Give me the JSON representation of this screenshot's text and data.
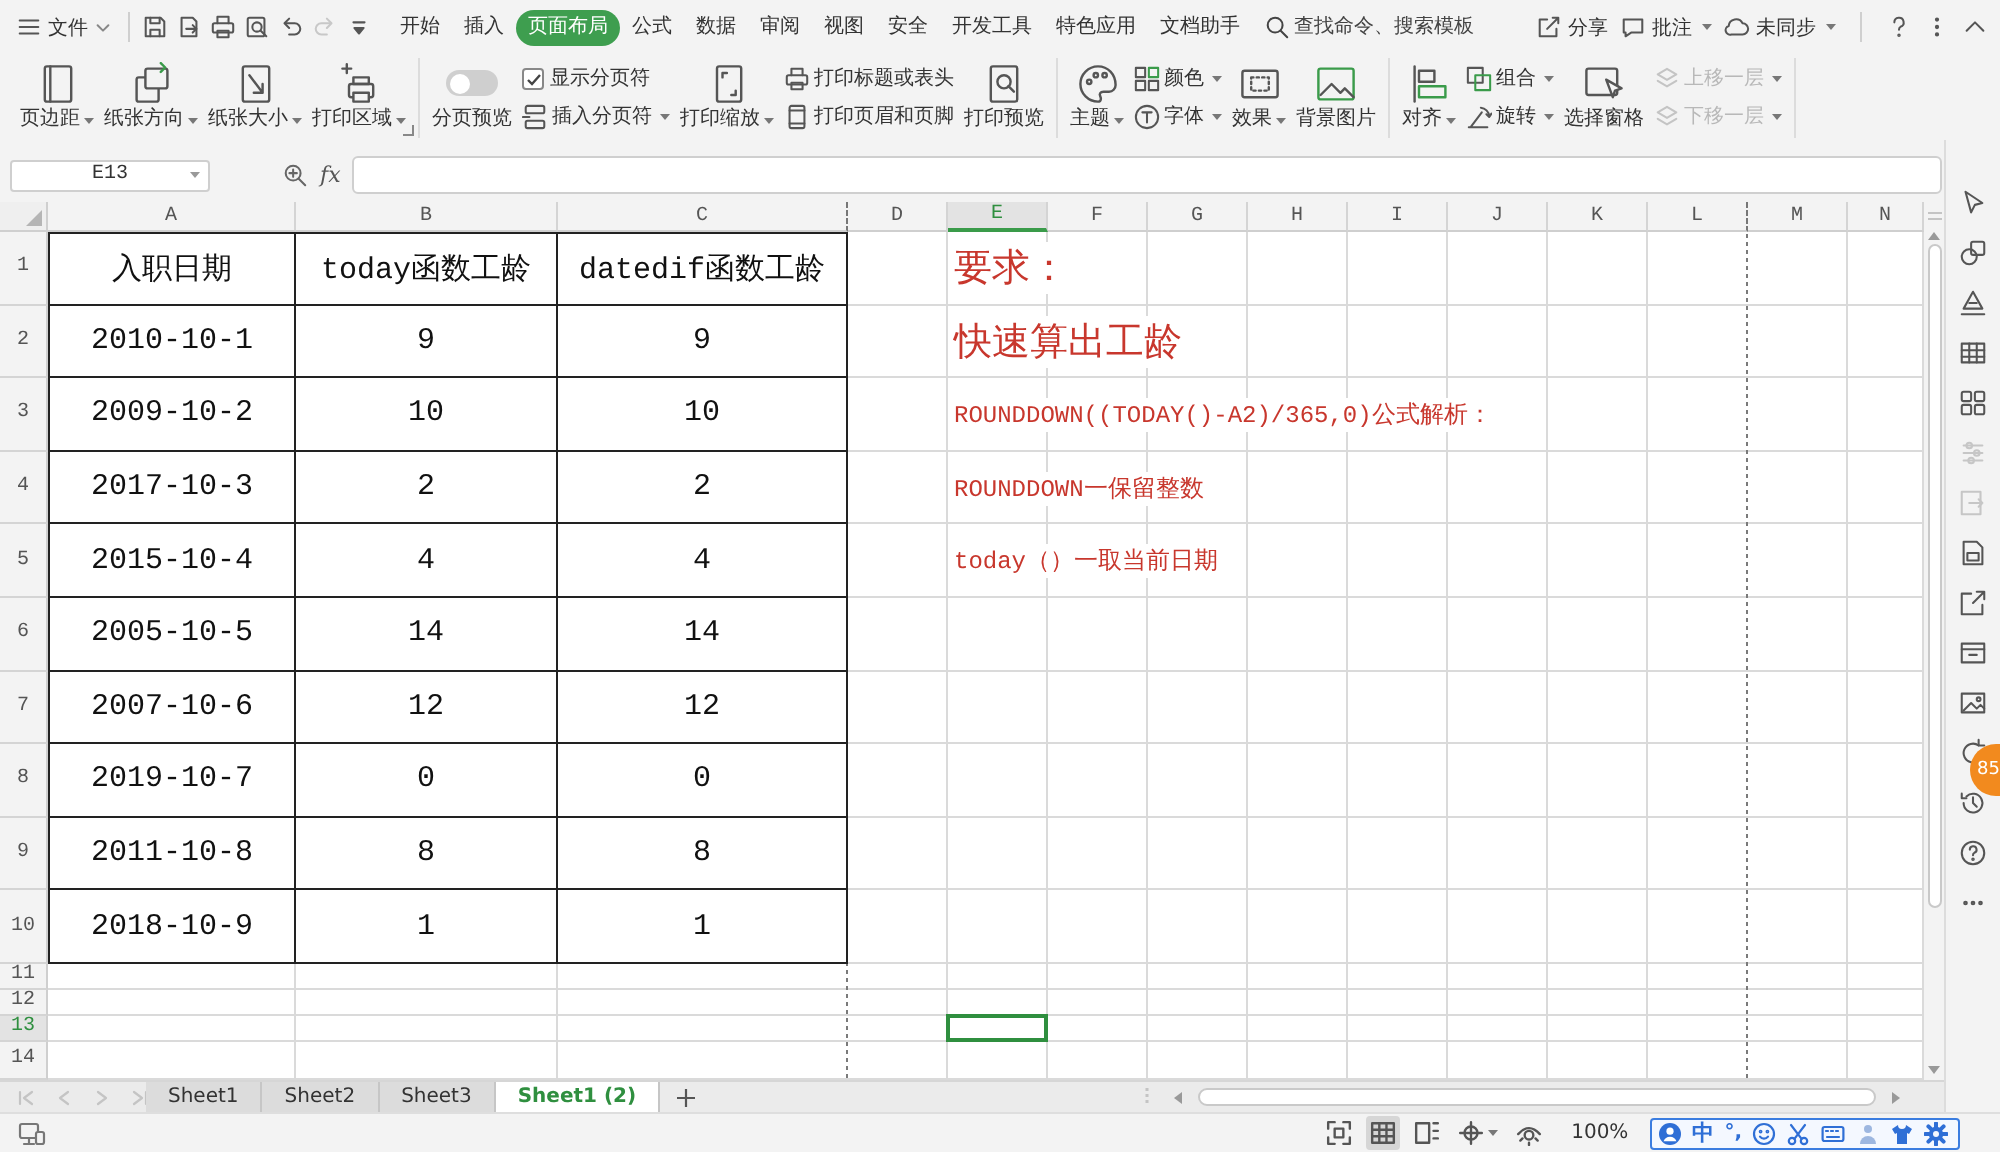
{
  "menu_bar": {
    "file_menu": "文件",
    "quick_access": [
      {
        "disabled": false
      },
      {
        "disabled": false
      },
      {
        "disabled": false
      },
      {
        "disabled": false
      },
      {
        "disabled": false
      },
      {
        "disabled": true
      },
      {
        "disabled": false
      }
    ],
    "tabs": [
      {
        "label": "开始",
        "selected": false
      },
      {
        "label": "插入",
        "selected": false
      },
      {
        "label": "页面布局",
        "selected": true
      },
      {
        "label": "公式",
        "selected": false
      },
      {
        "label": "数据",
        "selected": false
      },
      {
        "label": "审阅",
        "selected": false
      },
      {
        "label": "视图",
        "selected": false
      },
      {
        "label": "安全",
        "selected": false
      },
      {
        "label": "开发工具",
        "selected": false
      },
      {
        "label": "特色应用",
        "selected": false
      },
      {
        "label": "文档助手",
        "selected": false
      }
    ],
    "search": {
      "placeholder": "查找命令、搜索模板"
    },
    "actions": [
      {
        "label": "分享",
        "dropdown": false
      },
      {
        "label": "批注",
        "dropdown": true
      },
      {
        "label": "未同步",
        "dropdown": true
      }
    ]
  },
  "ribbon": {
    "groups": [
      {
        "items": [
          {
            "kind": "large",
            "label": "页边距",
            "dropdown": true
          },
          {
            "kind": "large",
            "label": "纸张方向",
            "dropdown": true
          },
          {
            "kind": "large",
            "label": "纸张大小",
            "dropdown": true
          },
          {
            "kind": "large",
            "label": "打印区域",
            "dropdown": true
          }
        ]
      },
      {
        "items": [
          {
            "kind": "toggle",
            "label": "分页预览",
            "on": false
          },
          {
            "kind": "stack",
            "items": [
              {
                "kind": "checkbox",
                "label": "显示分页符",
                "checked": true
              },
              {
                "kind": "small",
                "label": "插入分页符",
                "dropdown": true,
                "disabled": false
              }
            ]
          },
          {
            "kind": "large",
            "label": "打印缩放",
            "dropdown": true
          },
          {
            "kind": "stack",
            "items": [
              {
                "kind": "small",
                "label": "打印标题或表头",
                "dropdown": false,
                "disabled": false
              },
              {
                "kind": "small",
                "label": "打印页眉和页脚",
                "dropdown": false,
                "disabled": false
              }
            ]
          },
          {
            "kind": "large",
            "label": "打印预览",
            "dropdown": false
          }
        ]
      },
      {
        "items": [
          {
            "kind": "large",
            "label": "主题",
            "dropdown": true
          },
          {
            "kind": "stack",
            "items": [
              {
                "kind": "small",
                "label": "颜色",
                "dropdown": true,
                "disabled": false
              },
              {
                "kind": "small",
                "label": "字体",
                "dropdown": true,
                "disabled": false
              }
            ]
          },
          {
            "kind": "large",
            "label": "效果",
            "dropdown": true
          },
          {
            "kind": "large",
            "label": "背景图片",
            "dropdown": false
          }
        ]
      },
      {
        "items": [
          {
            "kind": "large",
            "label": "对齐",
            "dropdown": true
          },
          {
            "kind": "stack",
            "items": [
              {
                "kind": "small",
                "label": "组合",
                "dropdown": true,
                "disabled": false
              },
              {
                "kind": "small",
                "label": "旋转",
                "dropdown": true,
                "disabled": false
              }
            ]
          },
          {
            "kind": "large",
            "label": "选择窗格",
            "dropdown": false
          },
          {
            "kind": "stack",
            "items": [
              {
                "kind": "small",
                "label": "上移一层",
                "dropdown": true,
                "disabled": true
              },
              {
                "kind": "small",
                "label": "下移一层",
                "dropdown": true,
                "disabled": true
              }
            ]
          }
        ]
      }
    ]
  },
  "formula_bar": {
    "name_box": "E13",
    "function_label": "fx"
  },
  "sheet": {
    "columns": [
      {
        "label": "A",
        "selected": false,
        "page_break": false
      },
      {
        "label": "B",
        "selected": false,
        "page_break": false
      },
      {
        "label": "C",
        "selected": false,
        "page_break": true
      },
      {
        "label": "D",
        "selected": false,
        "page_break": false
      },
      {
        "label": "E",
        "selected": true,
        "page_break": false
      },
      {
        "label": "F",
        "selected": false,
        "page_break": false
      },
      {
        "label": "G",
        "selected": false,
        "page_break": false
      },
      {
        "label": "H",
        "selected": false,
        "page_break": false
      },
      {
        "label": "I",
        "selected": false,
        "page_break": false
      },
      {
        "label": "J",
        "selected": false,
        "page_break": false
      },
      {
        "label": "K",
        "selected": false,
        "page_break": false
      },
      {
        "label": "L",
        "selected": false,
        "page_break": true
      },
      {
        "label": "M",
        "selected": false,
        "page_break": false
      },
      {
        "label": "N",
        "selected": false,
        "page_break": false
      }
    ],
    "rows": [
      {
        "label": "1",
        "selected": false
      },
      {
        "label": "2",
        "selected": false
      },
      {
        "label": "3",
        "selected": false
      },
      {
        "label": "4",
        "selected": false
      },
      {
        "label": "5",
        "selected": false
      },
      {
        "label": "6",
        "selected": false
      },
      {
        "label": "7",
        "selected": false
      },
      {
        "label": "8",
        "selected": false
      },
      {
        "label": "9",
        "selected": false
      },
      {
        "label": "10",
        "selected": false
      },
      {
        "label": "11",
        "selected": false
      },
      {
        "label": "12",
        "selected": false
      },
      {
        "label": "13",
        "selected": true
      },
      {
        "label": "14",
        "selected": false
      }
    ]
  },
  "table": {
    "header": [
      "入职日期",
      "today函数工龄",
      "datedif函数工龄"
    ],
    "rows": [
      [
        "2010-10-1",
        "9",
        "9"
      ],
      [
        "2009-10-2",
        "10",
        "10"
      ],
      [
        "2017-10-3",
        "2",
        "2"
      ],
      [
        "2015-10-4",
        "4",
        "4"
      ],
      [
        "2005-10-5",
        "14",
        "14"
      ],
      [
        "2007-10-6",
        "12",
        "12"
      ],
      [
        "2019-10-7",
        "0",
        "0"
      ],
      [
        "2011-10-8",
        "8",
        "8"
      ],
      [
        "2018-10-9",
        "1",
        "1"
      ]
    ]
  },
  "notes": [
    {
      "kind": "heading",
      "text": "要求："
    },
    {
      "kind": "heading",
      "text": "快速算出工龄"
    },
    {
      "kind": "body",
      "text": "ROUNDDOWN((TODAY()-A2)/365,0)公式解析："
    },
    {
      "kind": "body",
      "text": "ROUNDDOWN一保留整数"
    },
    {
      "kind": "body",
      "text": "today（）一取当前日期"
    }
  ],
  "sheet_tabs": {
    "nav": [
      {
        "disabled": true
      },
      {
        "disabled": true
      },
      {
        "disabled": true
      },
      {
        "disabled": true
      }
    ],
    "tabs": [
      {
        "label": "Sheet1",
        "selected": false
      },
      {
        "label": "Sheet2",
        "selected": false
      },
      {
        "label": "Sheet3",
        "selected": false
      },
      {
        "label": "Sheet1 (2)",
        "selected": true
      }
    ]
  },
  "sidebar": {
    "tools": [
      {
        "disabled": false
      },
      {
        "disabled": false
      },
      {
        "disabled": false
      },
      {
        "disabled": false
      },
      {
        "disabled": false
      },
      {
        "disabled": true
      },
      {
        "disabled": true
      },
      {
        "disabled": false
      },
      {
        "disabled": false
      },
      {
        "disabled": false
      },
      {
        "disabled": false
      },
      {
        "disabled": false
      },
      {
        "disabled": false
      },
      {
        "disabled": false
      },
      {
        "disabled": false
      }
    ],
    "badge": "85"
  },
  "status_bar": {
    "views": [
      {
        "selected": false
      },
      {
        "selected": true
      },
      {
        "selected": false
      },
      {
        "selected": false
      },
      {
        "selected": false
      }
    ],
    "zoom": "100%",
    "ime": {
      "mode": "中",
      "punctuation": "°,"
    }
  }
}
